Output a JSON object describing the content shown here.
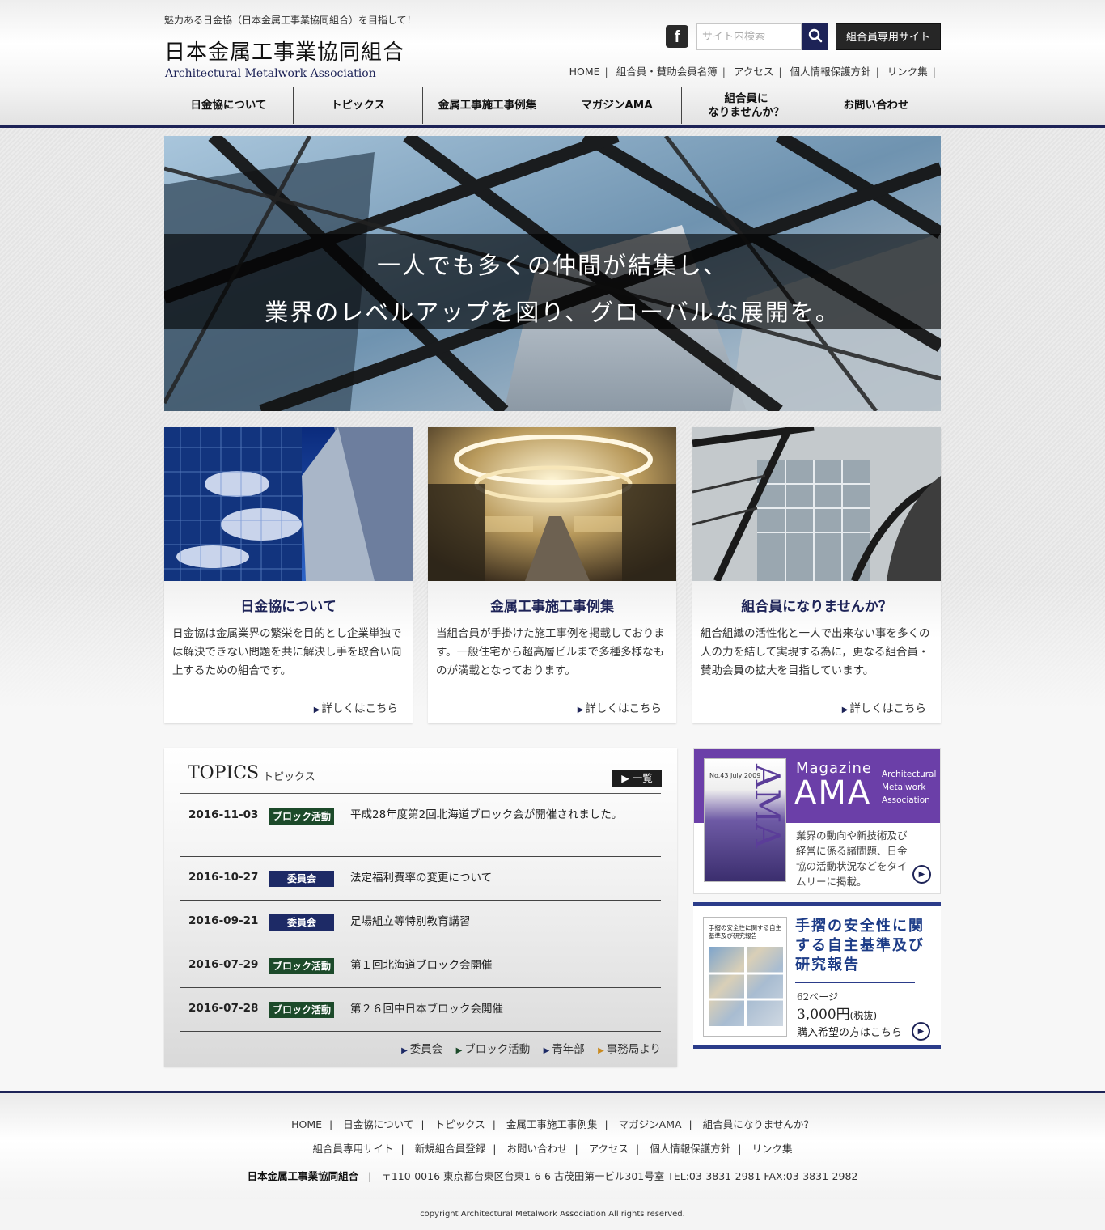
{
  "header": {
    "tagline": "魅力ある日金協（日本金属工事業協同組合）を目指して！",
    "logo_jp": "日本金属工事業協同組合",
    "logo_en": "Architectural Metalwork Association",
    "search_placeholder": "サイト内検索",
    "member_site_label": "組合員専用サイト",
    "facebook_icon": "facebook-icon",
    "util_nav": [
      "HOME",
      "組合員・賛助会員名簿",
      "アクセス",
      "個人情報保護方針",
      "リンク集"
    ],
    "global_nav": [
      "日金協について",
      "トピックス",
      "金属工事施工事例集",
      "マガジンAMA",
      "組合員に\nなりませんか？",
      "お問い合わせ"
    ]
  },
  "hero": {
    "line1": "一人でも多くの仲間が結集し、",
    "line2": "業界のレベルアップを図り、グローバルな展開を。"
  },
  "cards": [
    {
      "title": "日金協について",
      "text": "日金協は金属業界の繁栄を目的とし企業単独では解決できない問題を共に解決し手を取合い向上するための組合です。",
      "more": "詳しくはこちら"
    },
    {
      "title": "金属工事施工事例集",
      "text": "当組合員が手掛けた施工事例を掲載しております。一般住宅から超高層ビルまで多種多様なものが満載となっております。",
      "more": "詳しくはこちら"
    },
    {
      "title": "組合員になりませんか？",
      "text": "組合組織の活性化と一人で出来ない事を多くの人の力を結して実現する為に，更なる組合員・賛助会員の拡大を目指しています。",
      "more": "詳しくはこちら"
    }
  ],
  "topics": {
    "title": "TOPICS",
    "subtitle": "トピックス",
    "all_label": "▶ 一覧",
    "items": [
      {
        "date": "2016-11-03",
        "badge": "ブロック活動",
        "badge_color": "#1c4a2a",
        "headline": "平成28年度第2回北海道ブロック会が開催されました。"
      },
      {
        "date": "2016-10-27",
        "badge": "委員会",
        "badge_color": "#1d2a66",
        "headline": "法定福利費率の変更について"
      },
      {
        "date": "2016-09-21",
        "badge": "委員会",
        "badge_color": "#1d2a66",
        "headline": "足場組立等特別教育講習"
      },
      {
        "date": "2016-07-29",
        "badge": "ブロック活動",
        "badge_color": "#1c4a2a",
        "headline": "第１回北海道ブロック会開催"
      },
      {
        "date": "2016-07-28",
        "badge": "ブロック活動",
        "badge_color": "#1c4a2a",
        "headline": "第２６回中日本ブロック会開催"
      }
    ],
    "categories": [
      {
        "label": "委員会",
        "color": "#1d2a66"
      },
      {
        "label": "ブロック活動",
        "color": "#1c4a2a"
      },
      {
        "label": "青年部",
        "color": "#1d2a66"
      },
      {
        "label": "事務局より",
        "color": "#c98a1e"
      }
    ]
  },
  "banner_ama": {
    "cover_small": "No.43 July 2009",
    "cover_letters": "AMA",
    "magazine": "Magazine",
    "ama": "AMA",
    "en": "Architectural Metalwork Association",
    "desc": "業界の動向や新技術及び経営に係る諸問題、日金協の活動状況などをタイムリーに掲載。"
  },
  "banner_rail": {
    "doc_title": "手摺の安全性に関する自主基準及び研究報告",
    "title": "手摺の安全性に関する自主基準及び研究報告",
    "pages": "62ページ",
    "price": "3,000円",
    "tax": "(税抜)",
    "cta": "購入希望の方はこちら"
  },
  "footer": {
    "nav1": [
      "HOME",
      "日金協について",
      "トピックス",
      "金属工事施工事例集",
      "マガジンAMA",
      "組合員になりませんか？"
    ],
    "nav2": [
      "組合員専用サイト",
      "新規組合員登録",
      "お問い合わせ",
      "アクセス",
      "個人情報保護方針",
      "リンク集"
    ],
    "org": "日本金属工事業協同組合",
    "address": "〒110-0016 東京都台東区台東1-6-6 古茂田第一ビル301号室 TEL:03-3831-2981 FAX:03-3831-2982",
    "copyright": "copyright Architectural Metalwork Association All rights reserved."
  }
}
